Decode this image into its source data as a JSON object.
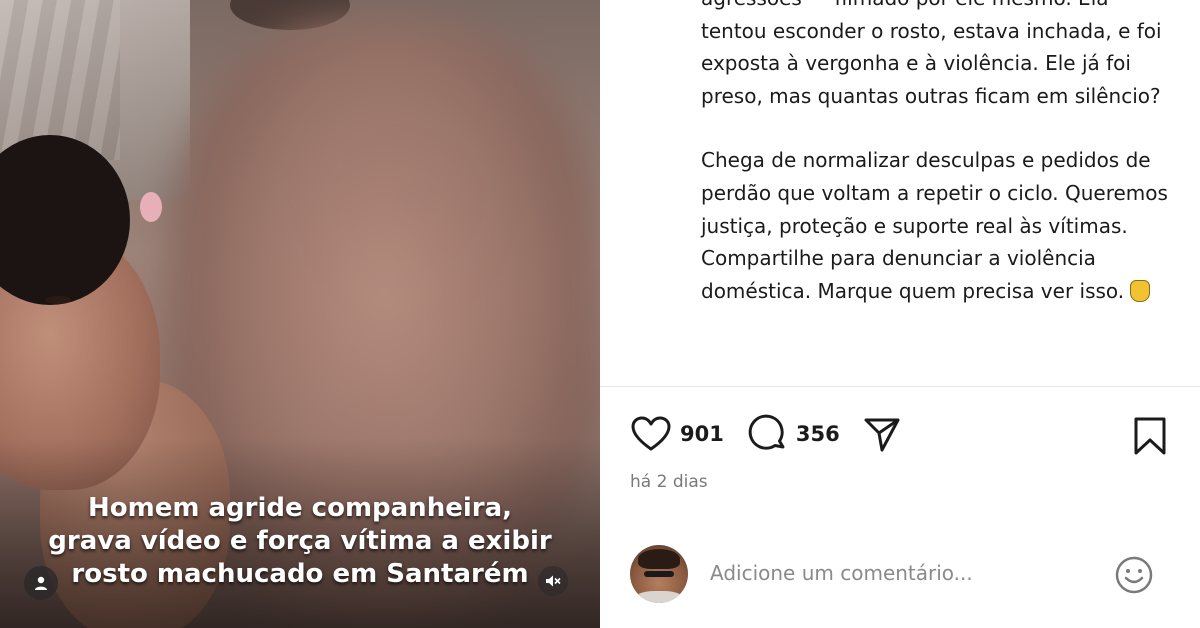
{
  "media": {
    "caption_lines": [
      "Homem agride companheira,",
      "grava vídeo e força vítima a exibir",
      "rosto machucado em Santarém"
    ],
    "icons": {
      "user": "user-icon",
      "mute": "mute-icon"
    }
  },
  "post": {
    "description": {
      "paragraph1": "agressões — filmado por ele mesmo. Ela tentou esconder o rosto, estava inchada, e foi exposta à vergonha e à violência. Ele já foi preso, mas quantas outras ficam em silêncio?",
      "paragraph2": "Chega de normalizar desculpas e pedidos de perdão que voltam a repetir o ciclo. Queremos justiça, proteção e suporte real às vítimas. Compartilhe para denunciar a violência doméstica. Marque quem precisa ver isso.",
      "emoji": "shield-emoji"
    },
    "likes": "901",
    "comments": "356",
    "time_ago": "há 2 dias",
    "icons": {
      "like": "heart-icon",
      "comment": "comment-bubble-icon",
      "share": "send-icon",
      "save": "bookmark-icon",
      "emoji": "smiley-icon"
    }
  },
  "comment_box": {
    "placeholder": "Adicione um comentário..."
  },
  "colors": {
    "text": "#1b1b1b",
    "muted": "#7a7a7a",
    "divider": "#e6e6e6"
  }
}
